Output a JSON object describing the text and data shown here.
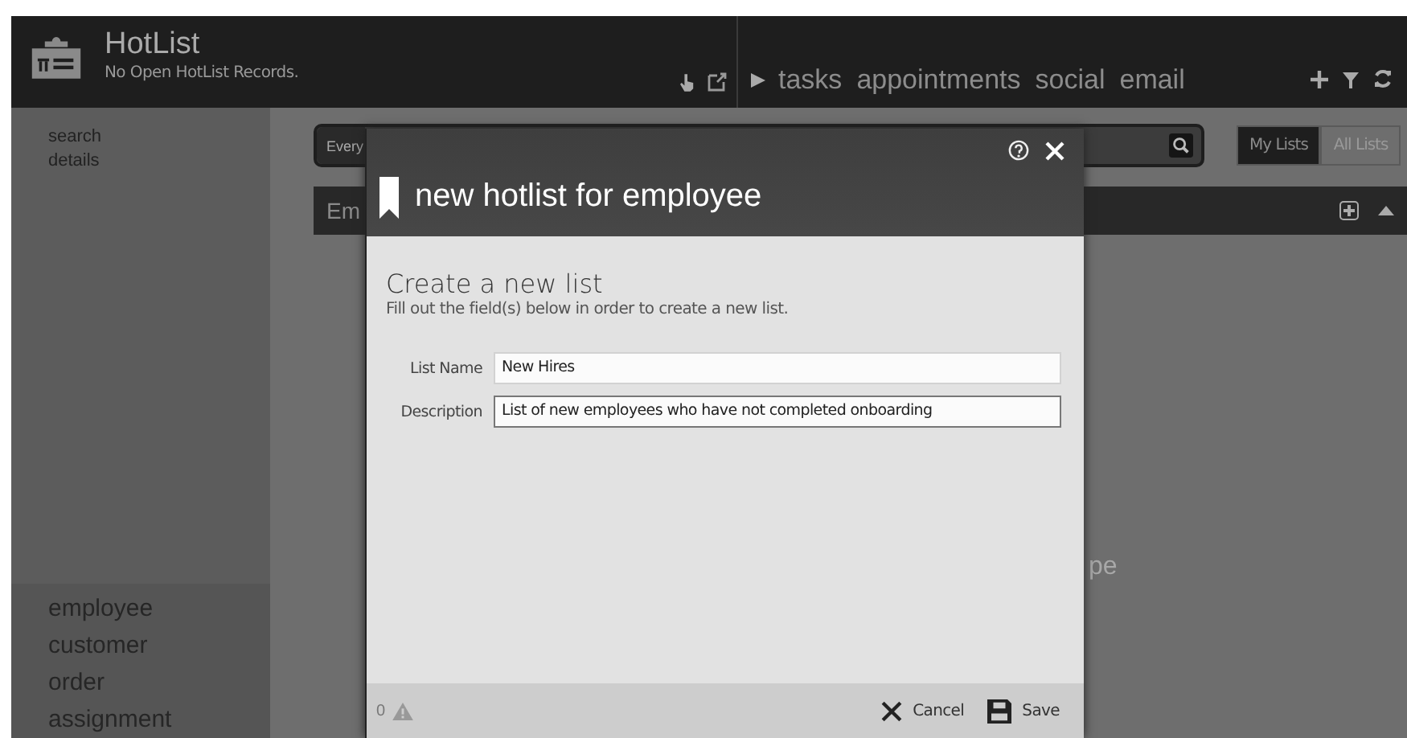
{
  "app": {
    "title": "HotList",
    "subtitle": "No Open HotList Records."
  },
  "nav": [
    {
      "label": "tasks"
    },
    {
      "label": "appointments"
    },
    {
      "label": "social"
    },
    {
      "label": "email"
    }
  ],
  "sidebar": {
    "links": [
      {
        "label": "search"
      },
      {
        "label": "details"
      }
    ],
    "entities": [
      {
        "label": "employee"
      },
      {
        "label": "customer"
      },
      {
        "label": "order"
      },
      {
        "label": "assignment"
      }
    ]
  },
  "main": {
    "search_scope": "Every",
    "list_tabs": [
      {
        "label": "My Lists",
        "selected": true
      },
      {
        "label": "All Lists",
        "selected": false
      }
    ],
    "bar_title": "Em",
    "empty_text": "pe"
  },
  "dialog": {
    "title": "new hotlist for employee",
    "heading": "Create a new list",
    "instructions": "Fill out the field(s) below in order to create a new list.",
    "fields": [
      {
        "label": "List Name",
        "value": "New Hires",
        "focused": false
      },
      {
        "label": "Description",
        "value": "List of new employees who have not completed onboarding",
        "focused": true
      }
    ],
    "warning_count": "0",
    "buttons": [
      {
        "kind": "cancel",
        "label": "Cancel"
      },
      {
        "kind": "save",
        "label": "Save"
      }
    ]
  }
}
